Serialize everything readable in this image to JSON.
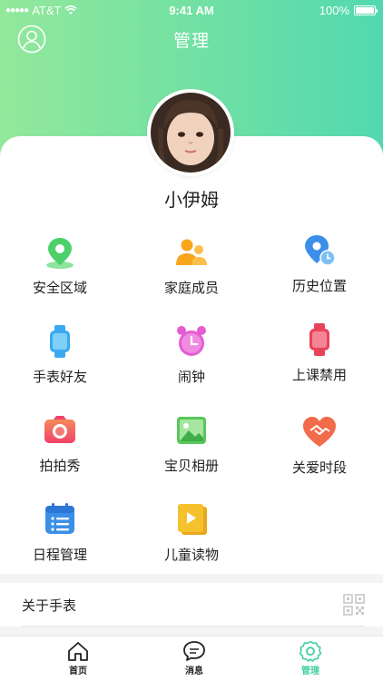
{
  "status_bar": {
    "carrier": "AT&T",
    "time": "9:41 AM",
    "battery": "100%"
  },
  "header": {
    "title": "管理",
    "profile_icon": "user-circle-icon"
  },
  "child": {
    "name": "小伊姆"
  },
  "features": [
    {
      "label": "安全区域",
      "icon": "location-pin-icon",
      "color": "#4cd06a"
    },
    {
      "label": "家庭成员",
      "icon": "family-members-icon",
      "color": "#f8a51c"
    },
    {
      "label": "历史位置",
      "icon": "history-location-icon",
      "color": "#3b8fe8"
    },
    {
      "label": "手表好友",
      "icon": "watch-friends-icon",
      "color": "#3ba9f0"
    },
    {
      "label": "闹钟",
      "icon": "alarm-clock-icon",
      "color": "#e45dd3"
    },
    {
      "label": "上课禁用",
      "icon": "class-disable-watch-icon",
      "color": "#e8435a"
    },
    {
      "label": "拍拍秀",
      "icon": "camera-icon",
      "color": "#f25f6e"
    },
    {
      "label": "宝贝相册",
      "icon": "photo-album-icon",
      "color": "#58c85a"
    },
    {
      "label": "关爱时段",
      "icon": "care-heart-icon",
      "color": "#f26b4a"
    },
    {
      "label": "日程管理",
      "icon": "schedule-icon",
      "color": "#3b8fe8"
    },
    {
      "label": "儿童读物",
      "icon": "children-book-icon",
      "color": "#f5c22e"
    }
  ],
  "about": {
    "label": "关于手表",
    "icon": "qr-code-icon"
  },
  "tabbar": [
    {
      "label": "首页",
      "icon": "home-icon",
      "active": false
    },
    {
      "label": "消息",
      "icon": "message-icon",
      "active": false
    },
    {
      "label": "管理",
      "icon": "settings-gear-icon",
      "active": true
    }
  ],
  "colors": {
    "accent": "#3ecf9a",
    "header_gradient_start": "#93e89b",
    "header_gradient_end": "#52d8b0"
  }
}
